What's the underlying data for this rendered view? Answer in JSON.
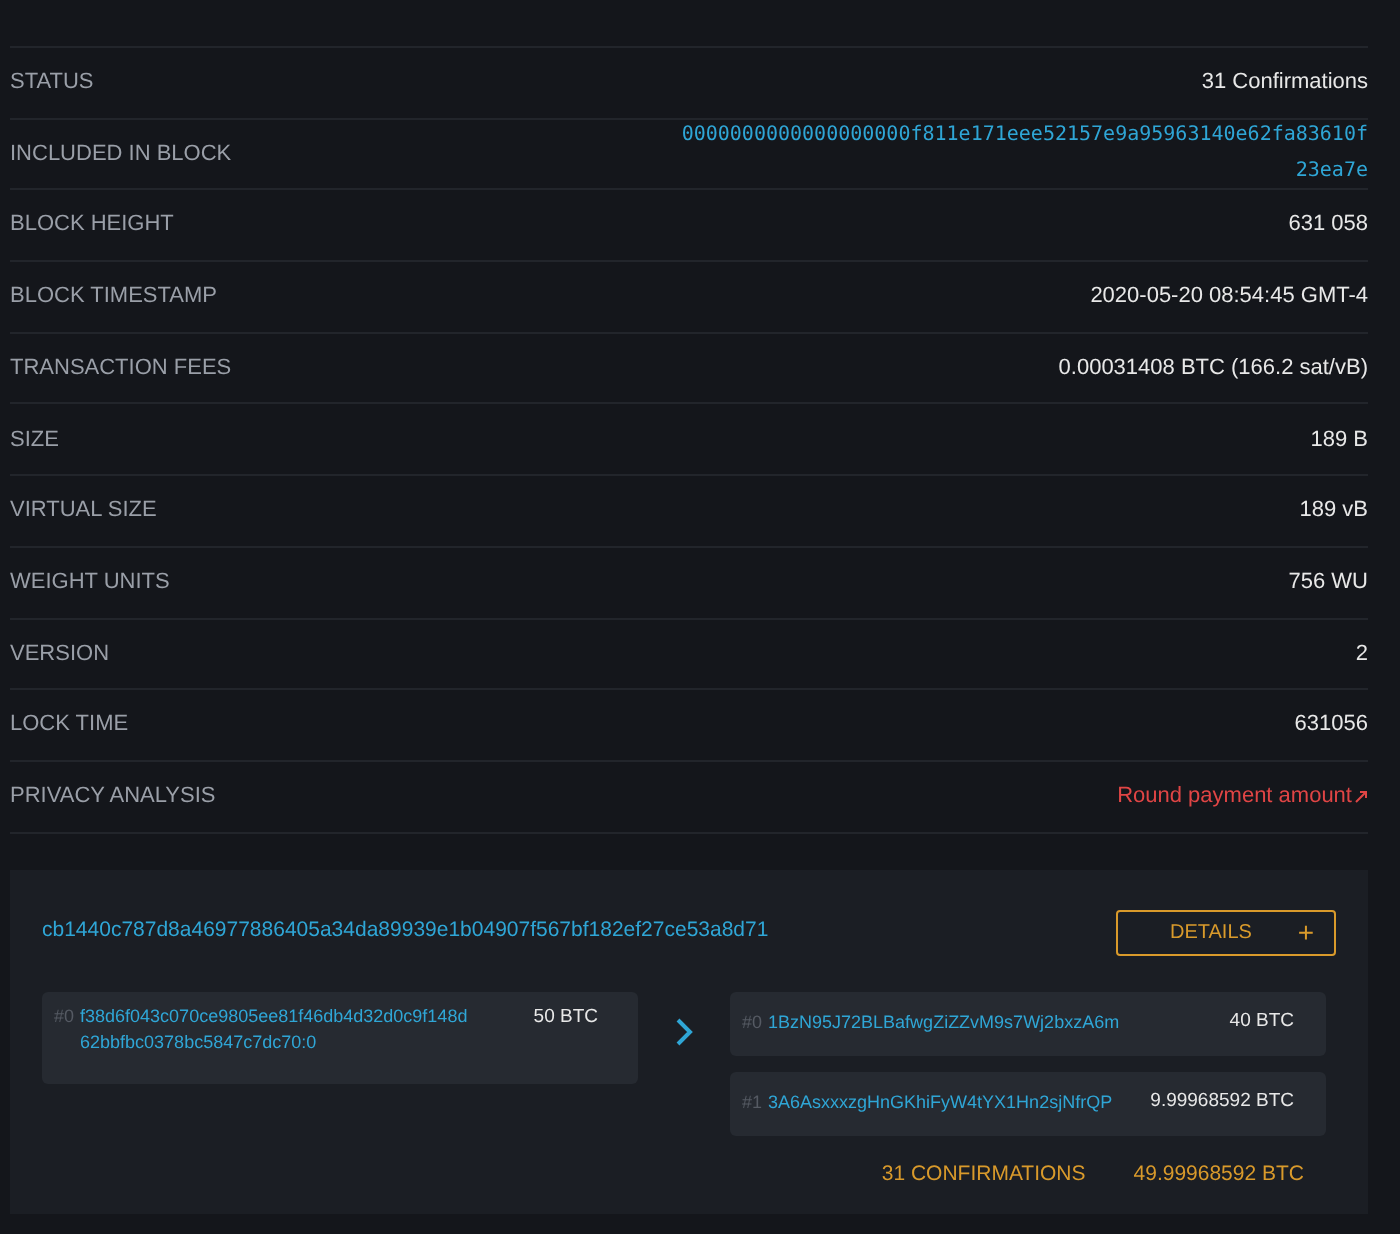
{
  "details": [
    {
      "label": "STATUS",
      "value": "31 Confirmations",
      "kind": "text"
    },
    {
      "label": "INCLUDED IN BLOCK",
      "value": "0000000000000000000f811e171eee52157e9a95963140e62fa83610f23ea7e",
      "kind": "link"
    },
    {
      "label": "BLOCK HEIGHT",
      "value": "631 058",
      "kind": "text"
    },
    {
      "label": "BLOCK TIMESTAMP",
      "value": "2020-05-20 08:54:45 GMT-4",
      "kind": "text"
    },
    {
      "label": "TRANSACTION FEES",
      "value": "0.00031408 BTC (166.2 sat/vB)",
      "kind": "text"
    },
    {
      "label": "SIZE",
      "value": "189 B",
      "kind": "text"
    },
    {
      "label": "VIRTUAL SIZE",
      "value": "189 vB",
      "kind": "text"
    },
    {
      "label": "WEIGHT UNITS",
      "value": "756 WU",
      "kind": "text"
    },
    {
      "label": "VERSION",
      "value": "2",
      "kind": "text"
    },
    {
      "label": "LOCK TIME",
      "value": "631056",
      "kind": "text"
    },
    {
      "label": "PRIVACY ANALYSIS",
      "value": "Round payment amount",
      "kind": "warning"
    }
  ],
  "transaction": {
    "txid": "cb1440c787d8a46977886405a34da89939e1b04907f567bf182ef27ce53a8d71",
    "details_button": "DETAILS",
    "details_icon": "+",
    "inputs": [
      {
        "index": "#0",
        "address": "f38d6f043c070ce9805ee81f46db4d32d0c9f148d62bbfbc0378bc5847c7dc70:0",
        "amount": "50 BTC"
      }
    ],
    "outputs": [
      {
        "index": "#0",
        "address": "1BzN95J72BLBafwgZiZZvM9s7Wj2bxzA6m",
        "amount": "40 BTC"
      },
      {
        "index": "#1",
        "address": "3A6AsxxxzgHnGKhiFyW4tYX1Hn2sjNfrQP",
        "amount": "9.99968592 BTC"
      }
    ],
    "confirmations": "31 CONFIRMATIONS",
    "total": "49.99968592 BTC"
  }
}
